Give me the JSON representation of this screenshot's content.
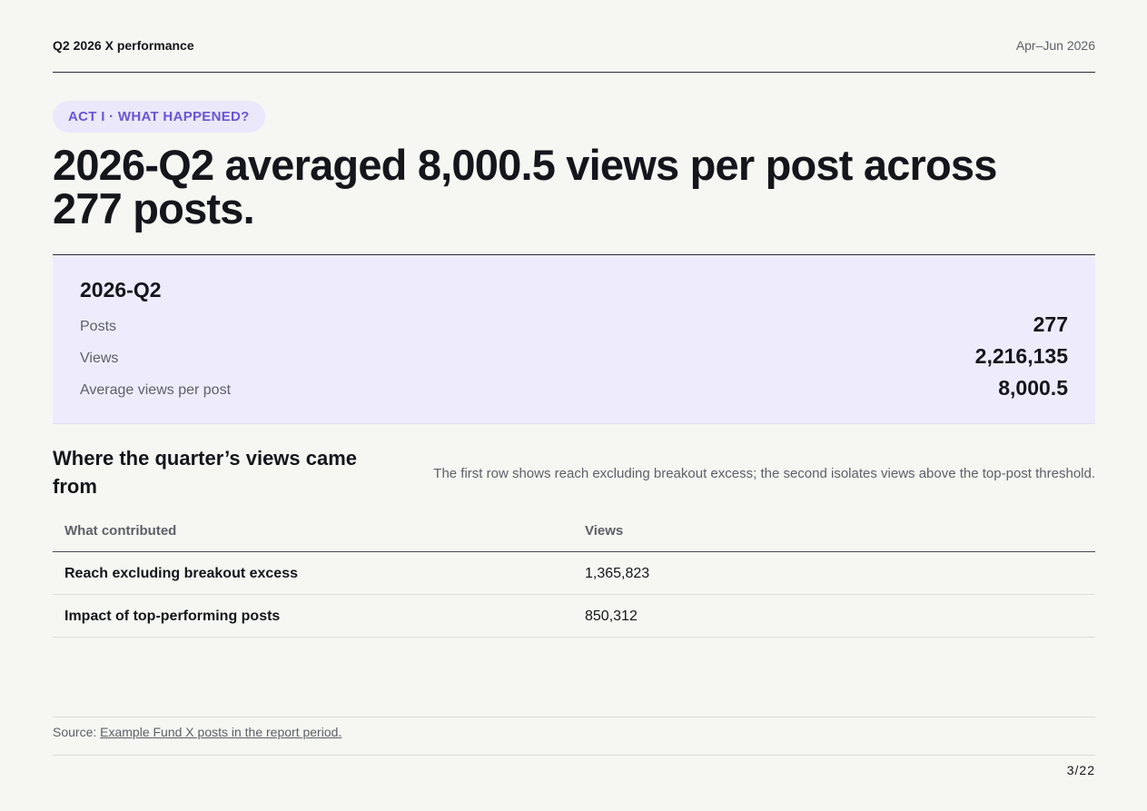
{
  "header": {
    "title": "Q2 2026 X performance",
    "period": "Apr–Jun 2026"
  },
  "act_label": "ACT I · WHAT HAPPENED?",
  "headline": "2026-Q2 averaged 8,000.5 views per post across 277 posts.",
  "summary": {
    "title": "2026-Q2",
    "rows": [
      {
        "label": "Posts",
        "value": "277"
      },
      {
        "label": "Views",
        "value": "2,216,135"
      },
      {
        "label": "Average views per post",
        "value": "8,000.5"
      }
    ]
  },
  "breakdown": {
    "title": "Where the quarter’s views came from",
    "note": "The first row shows reach excluding breakout excess; the second isolates views above the top-post threshold.",
    "columns": [
      "What contributed",
      "Views"
    ],
    "rows": [
      {
        "label": "Reach excluding breakout excess",
        "value": "1,365,823"
      },
      {
        "label": "Impact of top-performing posts",
        "value": "850,312"
      }
    ]
  },
  "source": {
    "prefix": "Source: ",
    "link_text": "Example Fund X posts in the report period."
  },
  "page_number": "3/22"
}
